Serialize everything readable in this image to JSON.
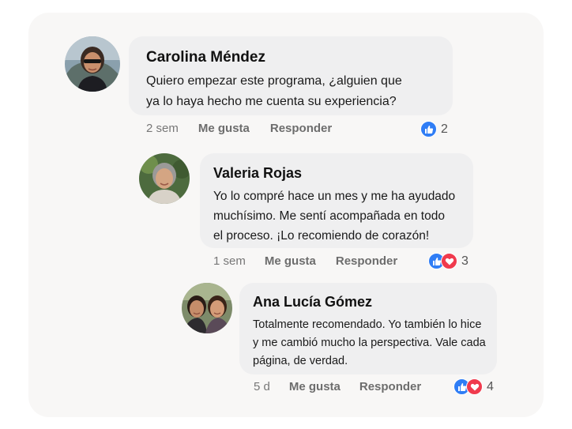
{
  "comments": [
    {
      "author": "Carolina Méndez",
      "text": "Quiero empezar este programa, ¿alguien que\nya lo haya hecho me cuenta su experiencia?",
      "time": "2 sem",
      "like_label": "Me gusta",
      "reply_label": "Responder",
      "reactions": [
        "like"
      ],
      "reaction_count": "2"
    },
    {
      "author": "Valeria Rojas",
      "text": "Yo lo compré hace un mes y me ha ayudado\nmuchísimo. Me sentí acompañada en todo\nel proceso. ¡Lo recomiendo de corazón!",
      "time": "1 sem",
      "like_label": "Me gusta",
      "reply_label": "Responder",
      "reactions": [
        "like",
        "love"
      ],
      "reaction_count": "3"
    },
    {
      "author": "Ana Lucía Gómez",
      "text": "Totalmente recomendado. Yo también lo hice\ny me cambió mucho la perspectiva. Vale cada\npágina, de verdad.",
      "time": "5 d",
      "like_label": "Me gusta",
      "reply_label": "Responder",
      "reactions": [
        "like",
        "love"
      ],
      "reaction_count": "4"
    }
  ],
  "colors": {
    "like": "#2f7df5",
    "love": "#f03a4d",
    "bubble": "#efeff0",
    "card": "#f8f7f6"
  }
}
